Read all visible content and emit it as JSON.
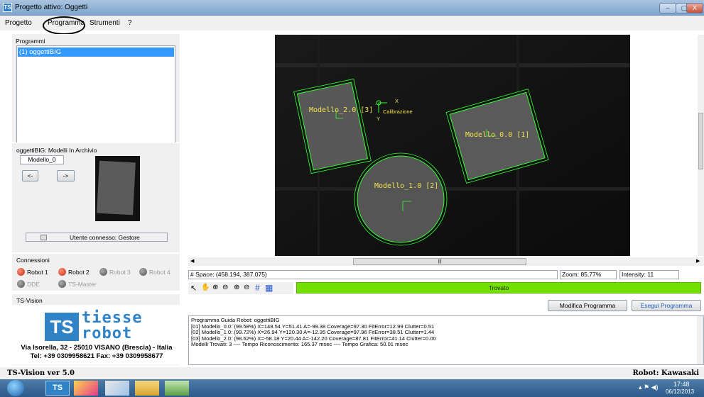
{
  "window": {
    "title": "Progetto attivo: Oggetti",
    "controls": [
      "–",
      "▢",
      "X"
    ]
  },
  "menu": {
    "items": [
      "Progetto",
      "Programma",
      "Strumenti",
      "?"
    ]
  },
  "left": {
    "programs_title": "Programmi",
    "program_selected": "(1) oggettiBIG",
    "models_title": "oggettiBIG: Modelli In Archivio",
    "model_name": "Modello_0",
    "prev_label": "<-",
    "next_label": "->",
    "user_label": "Utente connesso: Gestore",
    "connections_title": "Connessioni",
    "robots": [
      {
        "label": "Robot 1",
        "active": true
      },
      {
        "label": "Robot 2",
        "active": true
      },
      {
        "label": "Robot 3",
        "active": false
      },
      {
        "label": "Robot 4",
        "active": false
      }
    ],
    "dde_label": "DDE",
    "tsmaster_label": "TS-Master",
    "tsvision_title": "TS-Vision",
    "logo_word1": "tiesse",
    "logo_word2": "robot",
    "logo_initials": "TS",
    "address_line1": "Via Isorella, 32 - 25010 VISANO (Brescia) - Italia",
    "address_line2": "Tel: +39 0309958621 Fax: +39 0309958677"
  },
  "viewer": {
    "labels": [
      {
        "text": "Modello_2.0 [3]"
      },
      {
        "text": "Modello_0.0 [1]"
      },
      {
        "text": "Modello_1.0 [2]"
      },
      {
        "text": "Calibrazione"
      },
      {
        "text": "X"
      },
      {
        "text": "Y"
      }
    ],
    "scroll_mark": "|||"
  },
  "status": {
    "space": "# Space: (458.194, 387.075)",
    "zoom": "Zoom: 85,77%",
    "intensity": "Intensity: 11",
    "result": "Trovato"
  },
  "buttons": {
    "modify": "Modifica Programma",
    "run": "Esegui Programma"
  },
  "console": {
    "lines": [
      "Programma Guida Robot: oggettiBIG",
      "[01] Modello_0.0: (99.58%)  X=148.54  Y=51.41  A=-99.38  Coverage=97.30  FitError=12.99  Clutter=0.51",
      "[02] Modello_1.0: (99.72%)  X=26.94  Y=120.30  A=-12.35  Coverage=97.96  FitError=38.51  Clutter=1.44",
      "[03] Modello_2.0: (98.62%)  X=-58.18  Y=20.44  A=-142.20  Coverage=87.81  FitError=41.14  Clutter=0.00",
      "Modelli Trovati: 3  ----  Tempo Riconoscimento: 165.37 msec  ----  Tempo Grafica: 50.01 msec"
    ]
  },
  "footer": {
    "version": "TS-Vision ver 5.0",
    "robot": "Robot: Kawasaki"
  },
  "taskbar": {
    "time": "17:48",
    "date": "06/12/2013"
  },
  "colors": {
    "accent": "#3399ff",
    "ok_green": "#73e000",
    "label_yellow": "#f2e14a",
    "contour_green": "#33ff33",
    "robot_active": "#d63a22",
    "robot_inactive": "#6a6a6a"
  }
}
